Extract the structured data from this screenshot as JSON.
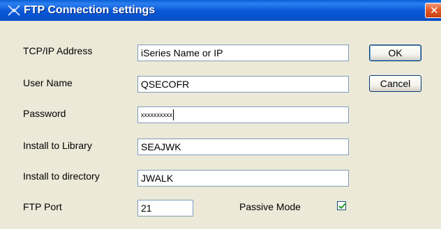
{
  "window": {
    "title": "FTP Connection settings",
    "close_glyph": "✕",
    "title_icon": "ftp-app-icon"
  },
  "fields": {
    "tcpip": {
      "label": "TCP/IP Address",
      "value": "iSeries Name or IP"
    },
    "username": {
      "label": "User Name",
      "value": "QSECOFR"
    },
    "password": {
      "label": "Password",
      "value": "xxxxxxxxxx"
    },
    "library": {
      "label": "Install to Library",
      "value": "SEAJWK"
    },
    "directory": {
      "label": "Install to directory",
      "value": "JWALK"
    },
    "port": {
      "label": "FTP Port",
      "value": "21"
    }
  },
  "passive": {
    "label": "Passive Mode",
    "checked": true
  },
  "buttons": {
    "ok": "OK",
    "cancel": "Cancel"
  },
  "colors": {
    "titlebar": "#0b59d8",
    "dialog_bg": "#ece9d8",
    "close_button": "#e35a2d",
    "field_border": "#7f9db9"
  }
}
